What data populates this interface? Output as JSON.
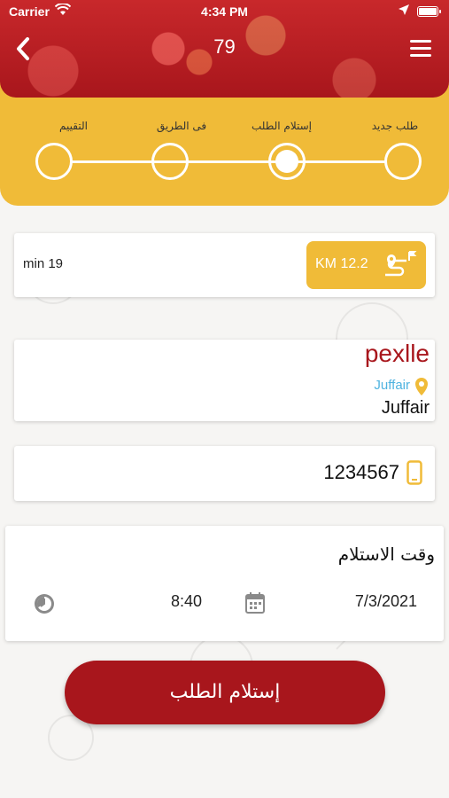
{
  "status_bar": {
    "carrier": "Carrier",
    "time": "4:34 PM"
  },
  "header": {
    "title": "79"
  },
  "steps": [
    {
      "label": "طلب جديد",
      "active": false
    },
    {
      "label": "إستلام الطلب",
      "active": true
    },
    {
      "label": "فى الطريق",
      "active": false
    },
    {
      "label": "التقييم",
      "active": false
    }
  ],
  "distance": {
    "duration": "min 19",
    "km": "KM 12.2"
  },
  "address": {
    "name": "pexlle",
    "area": "Juffair",
    "line": "Juffair"
  },
  "phone": {
    "number": "1234567"
  },
  "pickup": {
    "title": "وقت الاستلام",
    "date": "7/3/2021",
    "time": "8:40"
  },
  "action": {
    "button_label": "إستلام الطلب"
  },
  "colors": {
    "primary": "#a8161c",
    "accent": "#f0bb38",
    "link": "#4fb3e0"
  }
}
